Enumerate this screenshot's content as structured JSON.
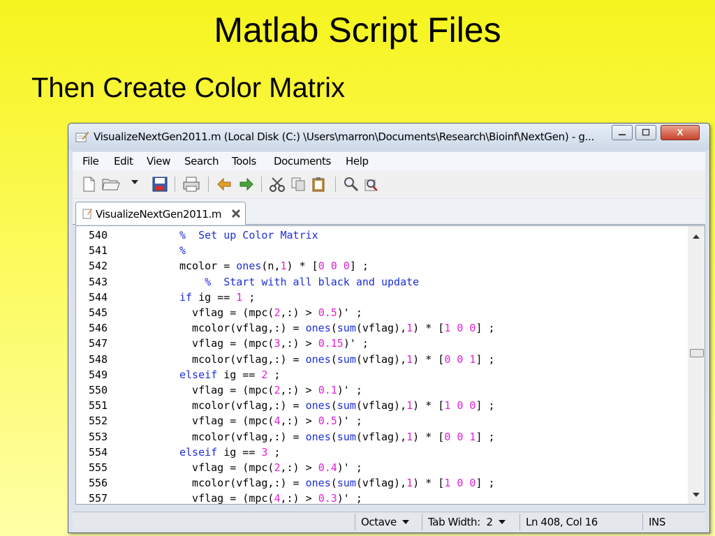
{
  "slide": {
    "title": "Matlab Script Files",
    "subtitle": "Then Create Color Matrix"
  },
  "window": {
    "title": "VisualizeNextGen2011.m (Local Disk (C:) \\Users\\marron\\Documents\\Research\\Bioinf\\NextGen) - g...",
    "buttons": {
      "close": "X"
    }
  },
  "menu": [
    "File",
    "Edit",
    "View",
    "Search",
    "Tools",
    "Documents",
    "Help"
  ],
  "toolbar": [
    "new-file-icon",
    "open-folder-icon",
    "dropdown-arrow-icon",
    "save-icon",
    "print-icon",
    "undo-icon",
    "redo-icon",
    "cut-icon",
    "copy-icon",
    "paste-icon",
    "find-icon",
    "find-replace-icon"
  ],
  "tab": {
    "label": "VisualizeNextGen2011.m"
  },
  "code": [
    {
      "ln": "540",
      "tokens": [
        {
          "t": "%  Set up Color Matrix",
          "c": "cm"
        }
      ]
    },
    {
      "ln": "541",
      "tokens": [
        {
          "t": "%",
          "c": "cm"
        }
      ]
    },
    {
      "ln": "542",
      "tokens": [
        {
          "t": "mcolor = "
        },
        {
          "t": "ones",
          "c": "fn"
        },
        {
          "t": "(n,"
        },
        {
          "t": "1",
          "c": "nm"
        },
        {
          "t": ") * ["
        },
        {
          "t": "0 0 0",
          "c": "nm"
        },
        {
          "t": "] ;"
        }
      ]
    },
    {
      "ln": "543",
      "tokens": [
        {
          "t": "    "
        },
        {
          "t": "%  Start with all black and update",
          "c": "cm"
        }
      ]
    },
    {
      "ln": "544",
      "tokens": [
        {
          "t": "if",
          "c": "kw"
        },
        {
          "t": " ig == "
        },
        {
          "t": "1",
          "c": "nm"
        },
        {
          "t": " ;"
        }
      ]
    },
    {
      "ln": "545",
      "tokens": [
        {
          "t": "  vflag = (mpc("
        },
        {
          "t": "2",
          "c": "nm"
        },
        {
          "t": ",:) > "
        },
        {
          "t": "0.5",
          "c": "nm"
        },
        {
          "t": ")' ;"
        }
      ]
    },
    {
      "ln": "546",
      "tokens": [
        {
          "t": "  mcolor(vflag,:) = "
        },
        {
          "t": "ones",
          "c": "fn"
        },
        {
          "t": "("
        },
        {
          "t": "sum",
          "c": "fn"
        },
        {
          "t": "(vflag),"
        },
        {
          "t": "1",
          "c": "nm"
        },
        {
          "t": ") * ["
        },
        {
          "t": "1 0 0",
          "c": "nm"
        },
        {
          "t": "] ;"
        }
      ]
    },
    {
      "ln": "547",
      "tokens": [
        {
          "t": "  vflag = (mpc("
        },
        {
          "t": "3",
          "c": "nm"
        },
        {
          "t": ",:) > "
        },
        {
          "t": "0.15",
          "c": "nm"
        },
        {
          "t": ")' ;"
        }
      ]
    },
    {
      "ln": "548",
      "tokens": [
        {
          "t": "  mcolor(vflag,:) = "
        },
        {
          "t": "ones",
          "c": "fn"
        },
        {
          "t": "("
        },
        {
          "t": "sum",
          "c": "fn"
        },
        {
          "t": "(vflag),"
        },
        {
          "t": "1",
          "c": "nm"
        },
        {
          "t": ") * ["
        },
        {
          "t": "0 0 1",
          "c": "nm"
        },
        {
          "t": "] ;"
        }
      ]
    },
    {
      "ln": "549",
      "tokens": [
        {
          "t": "elseif",
          "c": "kw"
        },
        {
          "t": " ig == "
        },
        {
          "t": "2",
          "c": "nm"
        },
        {
          "t": " ;"
        }
      ]
    },
    {
      "ln": "550",
      "tokens": [
        {
          "t": "  vflag = (mpc("
        },
        {
          "t": "2",
          "c": "nm"
        },
        {
          "t": ",:) > "
        },
        {
          "t": "0.1",
          "c": "nm"
        },
        {
          "t": ")' ;"
        }
      ]
    },
    {
      "ln": "551",
      "tokens": [
        {
          "t": "  mcolor(vflag,:) = "
        },
        {
          "t": "ones",
          "c": "fn"
        },
        {
          "t": "("
        },
        {
          "t": "sum",
          "c": "fn"
        },
        {
          "t": "(vflag),"
        },
        {
          "t": "1",
          "c": "nm"
        },
        {
          "t": ") * ["
        },
        {
          "t": "1 0 0",
          "c": "nm"
        },
        {
          "t": "] ;"
        }
      ]
    },
    {
      "ln": "552",
      "tokens": [
        {
          "t": "  vflag = (mpc("
        },
        {
          "t": "4",
          "c": "nm"
        },
        {
          "t": ",:) > "
        },
        {
          "t": "0.5",
          "c": "nm"
        },
        {
          "t": ")' ;"
        }
      ]
    },
    {
      "ln": "553",
      "tokens": [
        {
          "t": "  mcolor(vflag,:) = "
        },
        {
          "t": "ones",
          "c": "fn"
        },
        {
          "t": "("
        },
        {
          "t": "sum",
          "c": "fn"
        },
        {
          "t": "(vflag),"
        },
        {
          "t": "1",
          "c": "nm"
        },
        {
          "t": ") * ["
        },
        {
          "t": "0 0 1",
          "c": "nm"
        },
        {
          "t": "] ;"
        }
      ]
    },
    {
      "ln": "554",
      "tokens": [
        {
          "t": "elseif",
          "c": "kw"
        },
        {
          "t": " ig == "
        },
        {
          "t": "3",
          "c": "nm"
        },
        {
          "t": " ;"
        }
      ]
    },
    {
      "ln": "555",
      "tokens": [
        {
          "t": "  vflag = (mpc("
        },
        {
          "t": "2",
          "c": "nm"
        },
        {
          "t": ",:) > "
        },
        {
          "t": "0.4",
          "c": "nm"
        },
        {
          "t": ")' ;"
        }
      ]
    },
    {
      "ln": "556",
      "tokens": [
        {
          "t": "  mcolor(vflag,:) = "
        },
        {
          "t": "ones",
          "c": "fn"
        },
        {
          "t": "("
        },
        {
          "t": "sum",
          "c": "fn"
        },
        {
          "t": "(vflag),"
        },
        {
          "t": "1",
          "c": "nm"
        },
        {
          "t": ") * ["
        },
        {
          "t": "1 0 0",
          "c": "nm"
        },
        {
          "t": "] ;"
        }
      ]
    },
    {
      "ln": "557",
      "tokens": [
        {
          "t": "  vflag = (mpc("
        },
        {
          "t": "4",
          "c": "nm"
        },
        {
          "t": ",:) > "
        },
        {
          "t": "0.3",
          "c": "nm"
        },
        {
          "t": ")' ;"
        }
      ]
    }
  ],
  "status": {
    "language": "Octave",
    "tab_width": "Tab Width:  2",
    "position": "Ln 408, Col 16",
    "mode": "INS"
  },
  "colors": {
    "comment": "#1c2fd8",
    "keyword": "#1c2fd8",
    "number": "#e020d6",
    "background": "#f6f41e"
  }
}
